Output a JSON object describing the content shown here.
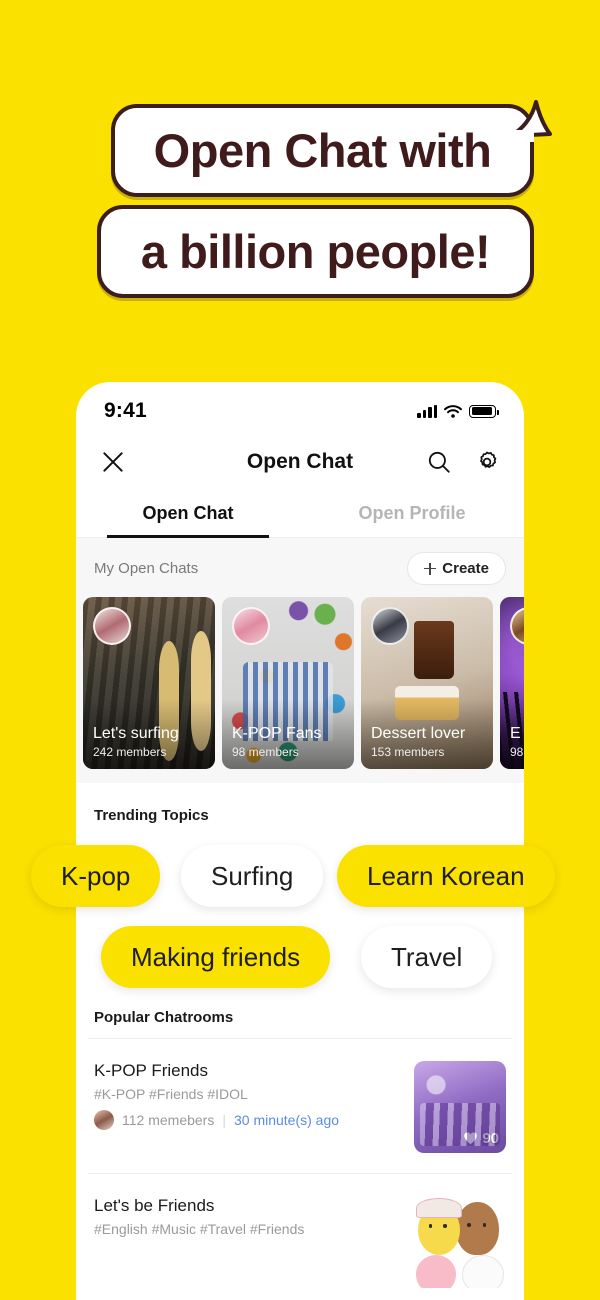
{
  "theme": {
    "brand_yellow": "#FAE100",
    "headline_color": "#3F1B1B",
    "link_blue": "#5B8BE8"
  },
  "hero": {
    "line1": "Open Chat with",
    "line2": "a billion people!"
  },
  "phone": {
    "status_bar": {
      "time": "9:41",
      "icons": [
        "signal-icon",
        "wifi-icon",
        "battery-icon"
      ]
    },
    "appbar": {
      "close_icon": "close-icon",
      "title": "Open Chat",
      "search_icon": "search-icon",
      "settings_icon": "gear-icon"
    },
    "tabs": [
      {
        "label": "Open Chat",
        "active": true
      },
      {
        "label": "Open Profile",
        "active": false
      }
    ],
    "my_open_chats": {
      "section_label": "My Open Chats",
      "create_label": "Create",
      "create_icon": "plus-icon",
      "cards": [
        {
          "name": "Let's surfing",
          "members": "242 members",
          "art": "ph-surf",
          "has_avatar": true
        },
        {
          "name": "K-POP Fans",
          "members": "98 members",
          "art": "ph-kpop",
          "has_avatar": true
        },
        {
          "name": "Dessert lover",
          "members": "153 members",
          "art": "ph-dessert",
          "has_avatar": true
        },
        {
          "name": "E",
          "members": "98",
          "art": "ph-concert",
          "has_avatar": true
        }
      ]
    },
    "trending": {
      "section_label": "Trending Topics",
      "chips": [
        {
          "label": "K-pop",
          "style": "yellow"
        },
        {
          "label": "Surfing",
          "style": "white"
        },
        {
          "label": "Learn Korean",
          "style": "yellow"
        },
        {
          "label": "Making friends",
          "style": "yellow"
        },
        {
          "label": "Travel",
          "style": "white"
        }
      ]
    },
    "popular": {
      "section_label": "Popular Chatrooms",
      "rooms": [
        {
          "name": "K-POP Friends",
          "tags": "#K-POP #Friends #IDOL",
          "members": "112 memebers",
          "separator": "|",
          "time": "30 minute(s) ago",
          "likes": "90",
          "thumb": "th-kpop"
        },
        {
          "name": "Let's be Friends",
          "tags": "#English #Music #Travel #Friends",
          "members": "",
          "separator": "",
          "time": "",
          "likes": "",
          "thumb": "th-friends"
        }
      ]
    }
  }
}
